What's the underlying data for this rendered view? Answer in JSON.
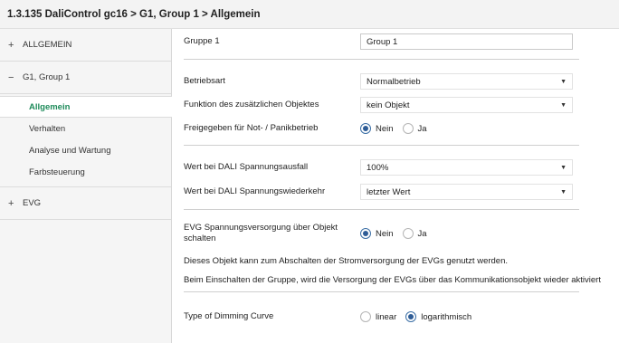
{
  "title": "1.3.135 DaliControl gc16 > G1, Group 1 > Allgemein",
  "sidebar": {
    "groups": [
      {
        "sign": "+",
        "label": "ALLGEMEIN"
      },
      {
        "sign": "−",
        "label": "G1, Group 1"
      },
      {
        "sign": "+",
        "label": "EVG"
      }
    ],
    "subitems": [
      {
        "label": "Allgemein"
      },
      {
        "label": "Verhalten"
      },
      {
        "label": "Analyse und Wartung"
      },
      {
        "label": "Farbsteuerung"
      }
    ]
  },
  "params": {
    "gruppe": {
      "label": "Gruppe 1",
      "value": "Group 1"
    },
    "betriebsart": {
      "label": "Betriebsart",
      "value": "Normalbetrieb"
    },
    "funktion": {
      "label": "Funktion des zusätzlichen Objektes",
      "value": "kein Objekt"
    },
    "freigegeben": {
      "label": "Freigegeben für Not- / Panikbetrieb",
      "opt1": "Nein",
      "opt2": "Ja"
    },
    "ausfall": {
      "label": "Wert bei DALI Spannungsausfall",
      "value": "100%"
    },
    "wiederkehr": {
      "label": "Wert bei DALI Spannungswiederkehr",
      "value": "letzter Wert"
    },
    "evg": {
      "label_line1": "EVG Spannungsversorgung über Objekt",
      "label_line2": "schalten",
      "opt1": "Nein",
      "opt2": "Ja"
    },
    "note1": "Dieses Objekt kann zum Abschalten der Stromversorgung der EVGs genutzt werden.",
    "note2": "Beim Einschalten der Gruppe, wird die Versorgung der EVGs über das Kommunikationsobjekt wieder aktiviert",
    "dimming": {
      "label": "Type of Dimming Curve",
      "opt1": "linear",
      "opt2": "logarithmisch"
    }
  }
}
